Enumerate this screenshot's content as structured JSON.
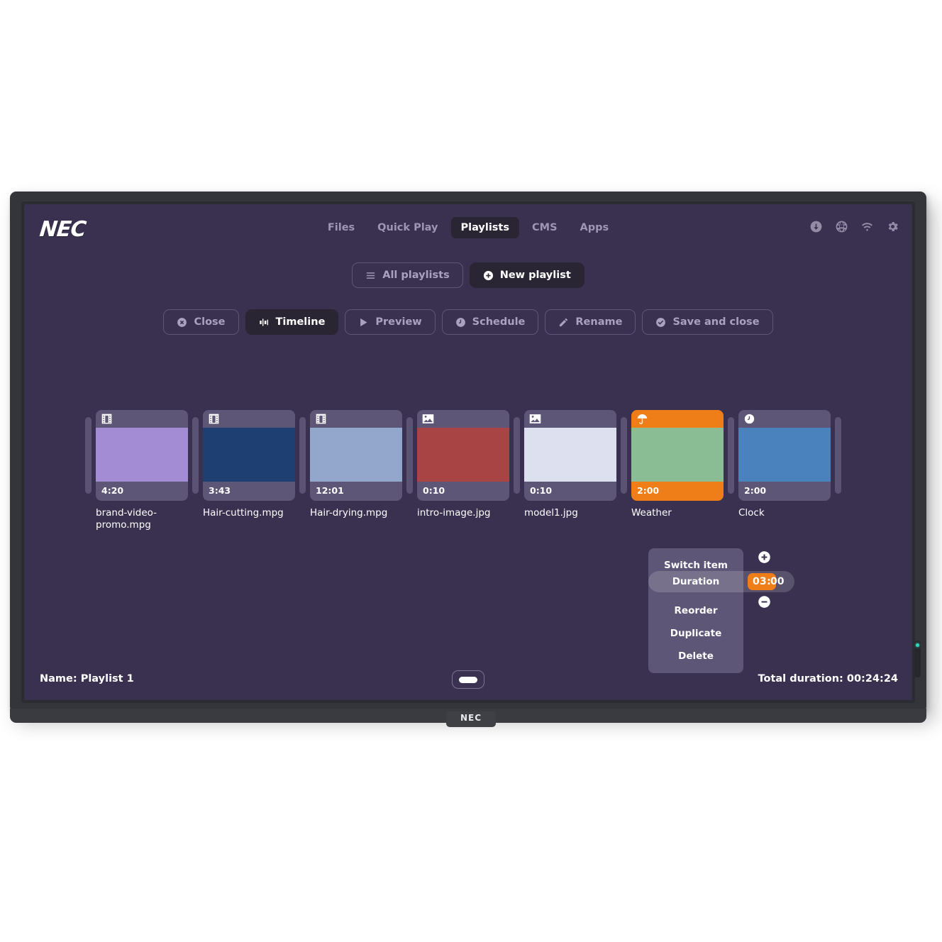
{
  "device": {
    "brand_logo": "NEC",
    "bezel_logo": "NEC",
    "sensor_led_color": "#2fd6c2"
  },
  "theme": {
    "screen_bg": "#3a3150",
    "card_bg": "#5d5676",
    "accent": "#ef7d18",
    "nav_active_bg": "#2a2533",
    "muted_text": "#9d96b4"
  },
  "nav": {
    "items": [
      {
        "label": "Files",
        "active": false
      },
      {
        "label": "Quick Play",
        "active": false
      },
      {
        "label": "Playlists",
        "active": true
      },
      {
        "label": "CMS",
        "active": false
      },
      {
        "label": "Apps",
        "active": false
      }
    ],
    "status_icons": [
      {
        "name": "download-icon"
      },
      {
        "name": "globe-icon"
      },
      {
        "name": "wifi-icon"
      },
      {
        "name": "gear-icon"
      }
    ]
  },
  "playlist_bar": {
    "all_playlists": {
      "label": "All playlists",
      "icon": "hamburger-icon"
    },
    "new_playlist": {
      "label": "New playlist",
      "icon": "plus-circle-icon"
    }
  },
  "toolbar": {
    "buttons": [
      {
        "label": "Close",
        "icon": "close-circle-icon",
        "active": false
      },
      {
        "label": "Timeline",
        "icon": "timeline-icon",
        "active": true
      },
      {
        "label": "Preview",
        "icon": "play-icon",
        "active": false
      },
      {
        "label": "Schedule",
        "icon": "clock-icon",
        "active": false
      },
      {
        "label": "Rename",
        "icon": "pencil-icon",
        "active": false
      },
      {
        "label": "Save and close",
        "icon": "check-circle-icon",
        "active": false
      }
    ]
  },
  "timeline": {
    "items": [
      {
        "name": "brand-video-promo.mpg",
        "duration": "4:20",
        "icon": "film-icon",
        "thumb_color": "#a48cd4",
        "selected": false
      },
      {
        "name": "Hair-cutting.mpg",
        "duration": "3:43",
        "icon": "film-icon",
        "thumb_color": "#1d3f72",
        "selected": false
      },
      {
        "name": "Hair-drying.mpg",
        "duration": "12:01",
        "icon": "film-icon",
        "thumb_color": "#93a6cb",
        "selected": false
      },
      {
        "name": "intro-image.jpg",
        "duration": "0:10",
        "icon": "image-icon",
        "thumb_color": "#a94444",
        "selected": false
      },
      {
        "name": "model1.jpg",
        "duration": "0:10",
        "icon": "image-icon",
        "thumb_color": "#dde0ef",
        "selected": false
      },
      {
        "name": "Weather",
        "duration": "2:00",
        "icon": "umbrella-icon",
        "thumb_color": "#8bbd95",
        "selected": true
      },
      {
        "name": "Clock",
        "duration": "2:00",
        "icon": "clock-icon",
        "thumb_color": "#4a82bd",
        "selected": false
      }
    ]
  },
  "context_menu": {
    "items": [
      {
        "label": "Switch item",
        "highlighted": false
      },
      {
        "label": "Duration",
        "highlighted": true
      },
      {
        "label": "Reorder",
        "highlighted": false
      },
      {
        "label": "Duplicate",
        "highlighted": false
      },
      {
        "label": "Delete",
        "highlighted": false
      }
    ],
    "duration_value_selected": "03:",
    "duration_value_rest": "00",
    "increment_icon": "plus-circle-icon",
    "decrement_icon": "minus-circle-icon"
  },
  "footer": {
    "name_label": "Name: Playlist 1",
    "total_duration_label": "Total duration: 00:24:24"
  }
}
